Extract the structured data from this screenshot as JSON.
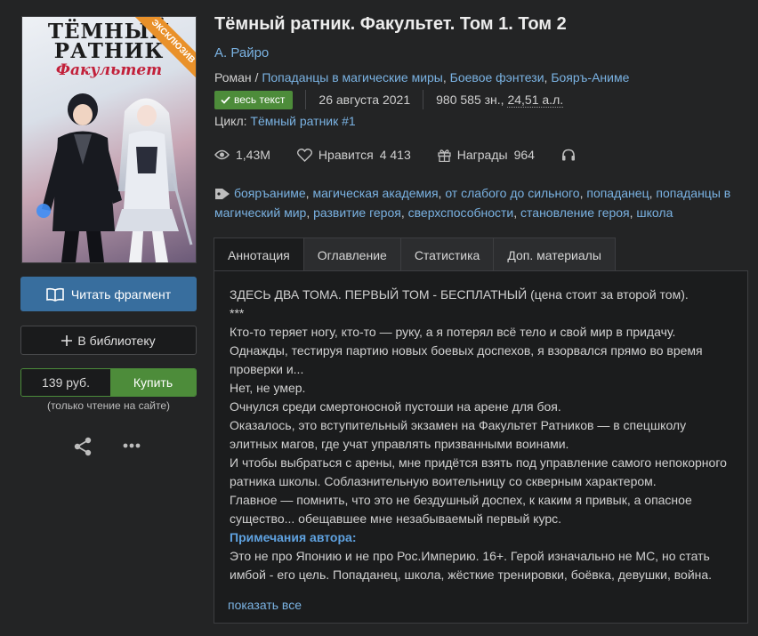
{
  "cover": {
    "title": "ТЁМНЫЙ РАТНИК",
    "subtitle": "Факультет",
    "ribbon": "ЭКСКЛЮЗИВ"
  },
  "actions": {
    "read_label": "Читать фрагмент",
    "library_label": "В библиотеку",
    "price": "139 руб.",
    "buy_label": "Купить",
    "buy_note": "(только чтение на сайте)"
  },
  "book": {
    "title": "Тёмный ратник. Факультет. Том 1. Том 2",
    "author": "А. Райро",
    "genre_root": "Роман",
    "genres": [
      "Попаданцы в магические миры",
      "Боевое фэнтези",
      "Бояръ-Аниме"
    ],
    "status_badge": "весь текст",
    "date": "26 августа 2021",
    "size_chars": "980 585 зн.,",
    "size_al": "24,51 а.л.",
    "cycle_label": "Цикл:",
    "cycle_name": "Тёмный ратник #1"
  },
  "stats": {
    "views": "1,43M",
    "likes_label": "Нравится",
    "likes": "4 413",
    "awards_label": "Награды",
    "awards": "964"
  },
  "tags": [
    "бояръаниме",
    "магическая академия",
    "от слабого до сильного",
    "попаданец",
    "попаданцы в магический мир",
    "развитие героя",
    "сверхспособности",
    "становление героя",
    "школа"
  ],
  "tabs": [
    "Аннотация",
    "Оглавление",
    "Статистика",
    "Доп. материалы"
  ],
  "annotation": {
    "lines": [
      "ЗДЕСЬ ДВА ТОМА. ПЕРВЫЙ ТОМ - БЕСПЛАТНЫЙ (цена стоит за второй том).",
      "***",
      "Кто-то теряет ногу, кто-то — руку, а я потерял всё тело и свой мир в придачу. Однажды, тестируя партию новых боевых доспехов, я взорвался прямо во время проверки и...",
      "Нет, не умер.",
      "Очнулся среди смертоносной пустоши на арене для боя.",
      "Оказалось, это вступительный экзамен на Факультет Ратников — в спецшколу элитных магов, где учат управлять призванными воинами.",
      "И чтобы выбраться с арены, мне придётся взять под управление самого непокорного ратника школы. Соблазнительную воительницу со скверным характером.",
      "Главное — помнить, что это не бездушный доспех, к каким я привык, а опасное существо... обещавшее мне незабываемый первый курс."
    ],
    "notes_heading": "Примечания автора:",
    "notes_text": "Это не про Японию и не про Рос.Империю. 16+. Герой изначально не МС, но стать имбой - его цель. Попаданец, школа, жёсткие тренировки, боёвка, девушки, война.",
    "show_all": "показать все"
  },
  "icons": {
    "views": "eye-icon",
    "likes": "heart-icon",
    "awards": "gift-icon",
    "audio": "headphones-icon",
    "tags": "tag-icon",
    "read": "book-icon",
    "library": "plus-icon",
    "share": "share-icon",
    "more": "more-icon",
    "badge": "check-icon"
  },
  "colors": {
    "background": "#232425",
    "link": "#7ab2e2",
    "primary_button": "#386e9e",
    "buy_green": "#4d8c3a",
    "notes_heading": "#5fa2e0"
  }
}
